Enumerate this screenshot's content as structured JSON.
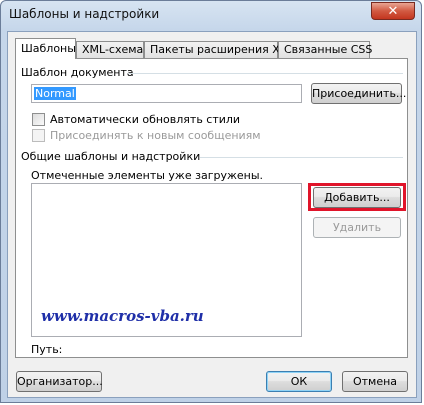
{
  "window": {
    "title": "Шаблоны и надстройки",
    "close_symbol": "✕"
  },
  "tabs": [
    {
      "label": "Шаблоны",
      "active": true
    },
    {
      "label": "XML-схема",
      "active": false
    },
    {
      "label": "Пакеты расширения XML",
      "active": false
    },
    {
      "label": "Связанные CSS",
      "active": false
    }
  ],
  "document_template": {
    "group_label": "Шаблон документа",
    "value": "Normal",
    "attach_button": "Присоединить...",
    "auto_update_label": "Автоматически обновлять стили",
    "auto_update_checked": false,
    "attach_new_label": "Присоединять к новым сообщениям",
    "attach_new_checked": false
  },
  "global_templates": {
    "group_label": "Общие шаблоны и надстройки",
    "note": "Отмеченные элементы уже загружены.",
    "add_button": "Добавить...",
    "remove_button": "Удалить",
    "path_label": "Путь:",
    "items": []
  },
  "watermark": "www.macros-vba.ru",
  "footer": {
    "organizer_button": "Организатор...",
    "ok_button": "ОК",
    "cancel_button": "Отмена"
  },
  "colors": {
    "highlight": "#e0142a",
    "selection": "#3399ff",
    "watermark": "#1f2fa8"
  }
}
